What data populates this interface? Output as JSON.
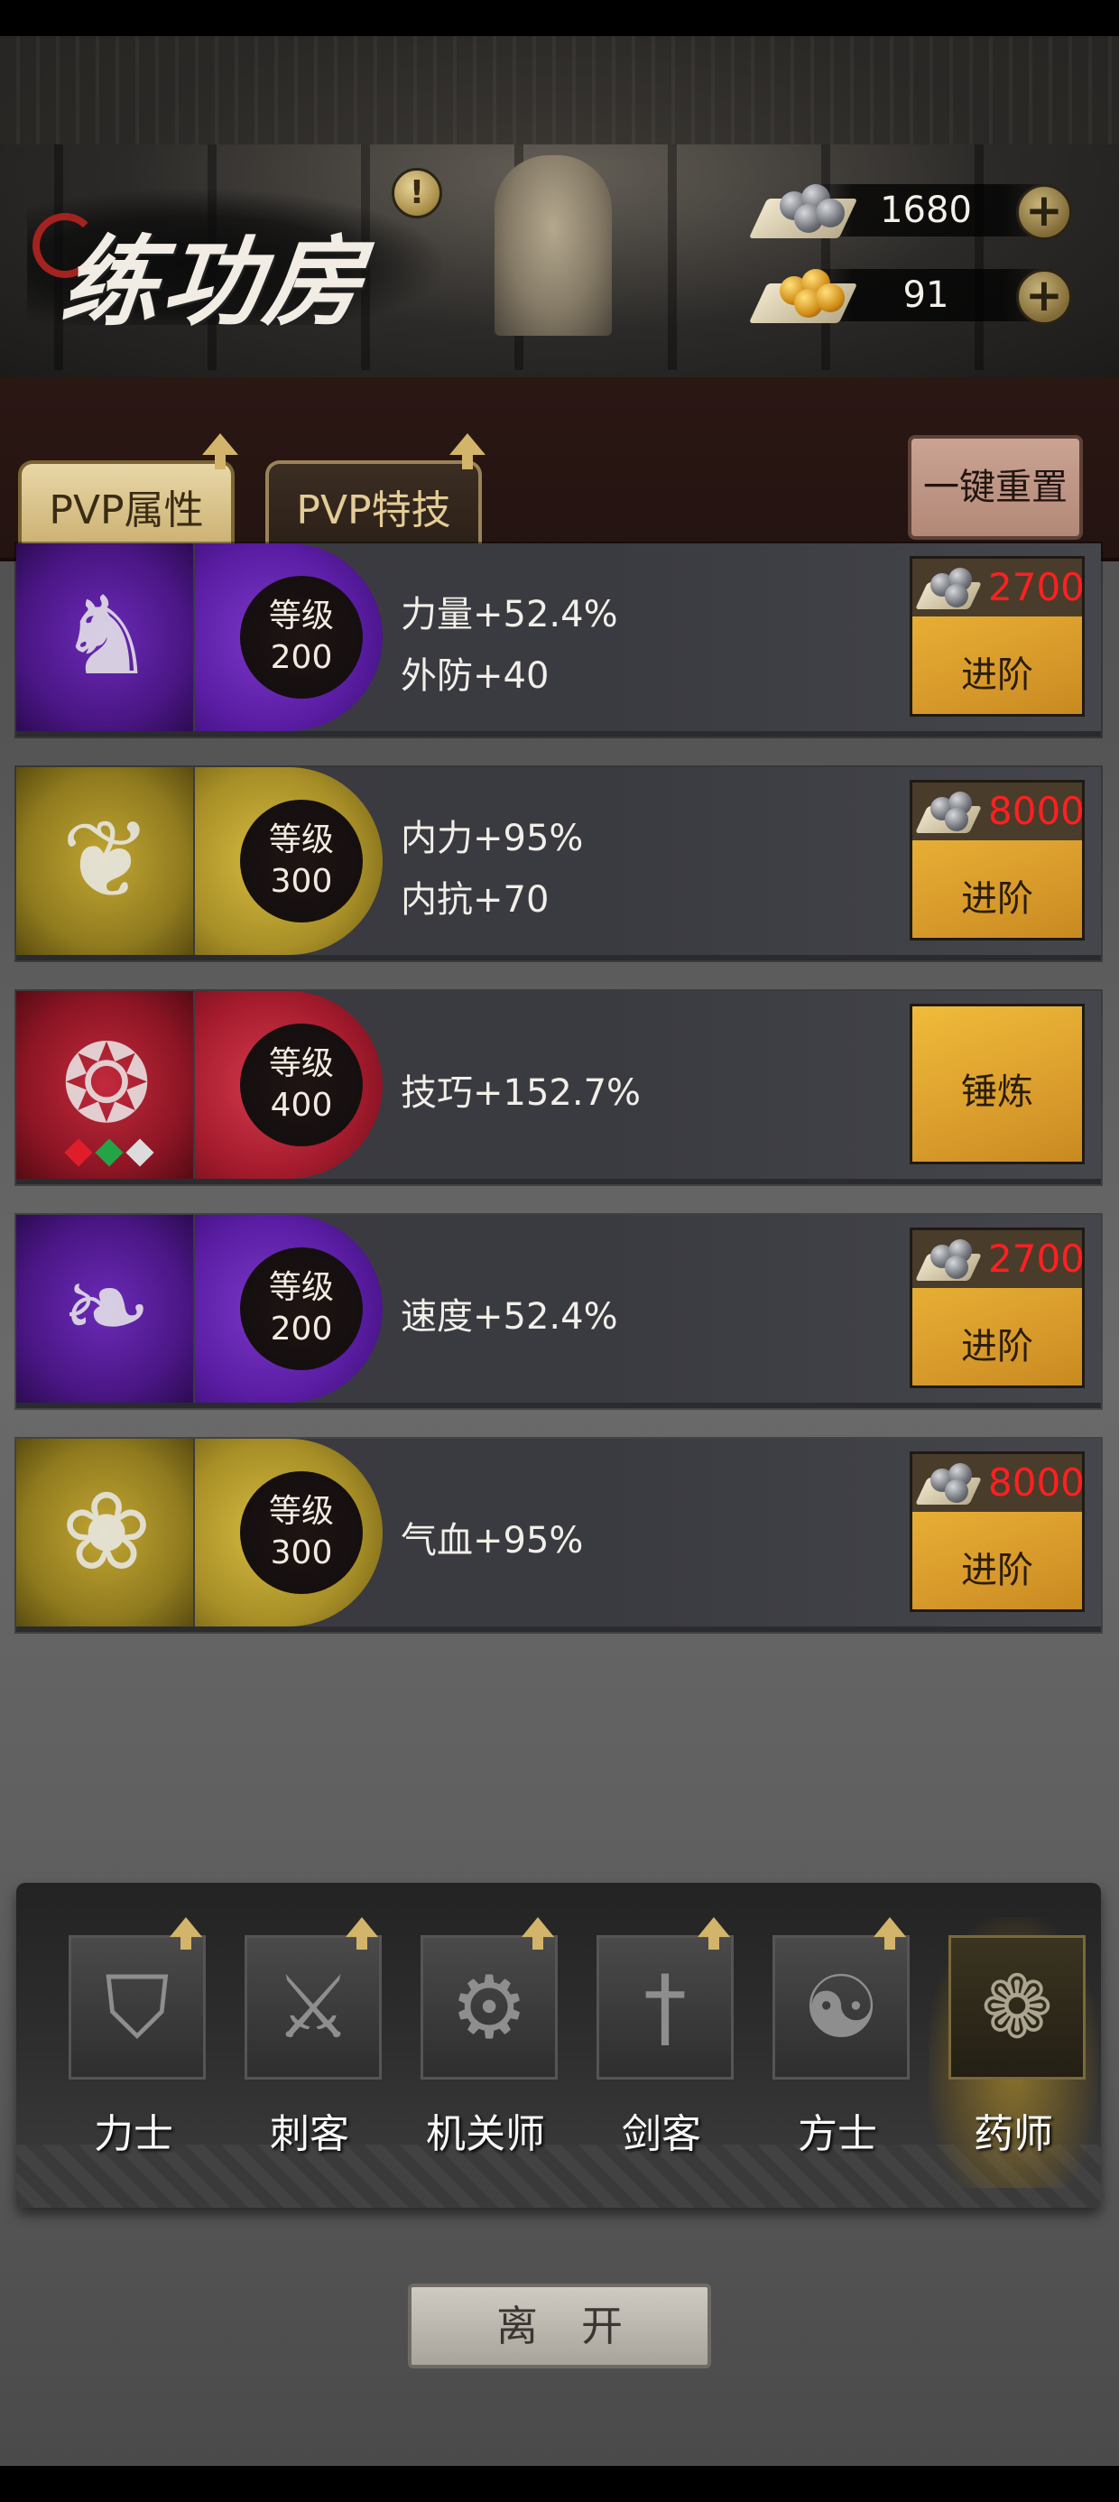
{
  "header": {
    "title": "练功房",
    "notice_icon": "!",
    "silver": {
      "icon": "silver-ingot-icon",
      "value": "1680",
      "plus": "+"
    },
    "gold": {
      "icon": "gold-ingot-icon",
      "value": "91",
      "plus": "+"
    }
  },
  "tabs": [
    {
      "label": "PVP属性",
      "active": true
    },
    {
      "label": "PVP特技",
      "active": false
    }
  ],
  "reset_button": "一键重置",
  "rows": [
    {
      "color": "purple",
      "emblem": "dragon-emblem-icon",
      "level_label": "等级",
      "level": "200",
      "stats": [
        "力量+52.4%",
        "外防+40"
      ],
      "cost": "2700",
      "action": "进阶"
    },
    {
      "color": "yellow",
      "emblem": "phoenix-emblem-icon",
      "level_label": "等级",
      "level": "300",
      "stats": [
        "内力+95%",
        "内抗+70"
      ],
      "cost": "8000",
      "action": "进阶"
    },
    {
      "color": "red",
      "emblem": "tiger-emblem-icon",
      "level_label": "等级",
      "level": "400",
      "stats": [
        "技巧+152.7%"
      ],
      "action": "锤炼",
      "gems": [
        "#e21d2a",
        "#22a447",
        "#dcdcdc"
      ]
    },
    {
      "color": "purple",
      "emblem": "beast-emblem-icon",
      "level_label": "等级",
      "level": "200",
      "stats": [
        "速度+52.4%"
      ],
      "cost": "2700",
      "action": "进阶"
    },
    {
      "color": "yellow",
      "emblem": "qilin-emblem-icon",
      "level_label": "等级",
      "level": "300",
      "stats": [
        "气血+95%"
      ],
      "cost": "8000",
      "action": "进阶"
    }
  ],
  "classes": [
    {
      "name": "力士",
      "icon": "helmet-icon",
      "glyph": "⛉",
      "selected": false
    },
    {
      "name": "刺客",
      "icon": "dagger-icon",
      "glyph": "⚔",
      "selected": false
    },
    {
      "name": "机关师",
      "icon": "gears-icon",
      "glyph": "⚙",
      "selected": false
    },
    {
      "name": "剑客",
      "icon": "sword-icon",
      "glyph": "†",
      "selected": false
    },
    {
      "name": "方士",
      "icon": "yin-yang-icon",
      "glyph": "☯",
      "selected": false
    },
    {
      "name": "药师",
      "icon": "cloud-beast-icon",
      "glyph": "❁",
      "selected": true
    }
  ],
  "leave_button": "离开",
  "colors": {
    "cost_text": "#ff2020",
    "button_gold": "#e3a832",
    "tab_active": "#e9d7a8"
  }
}
